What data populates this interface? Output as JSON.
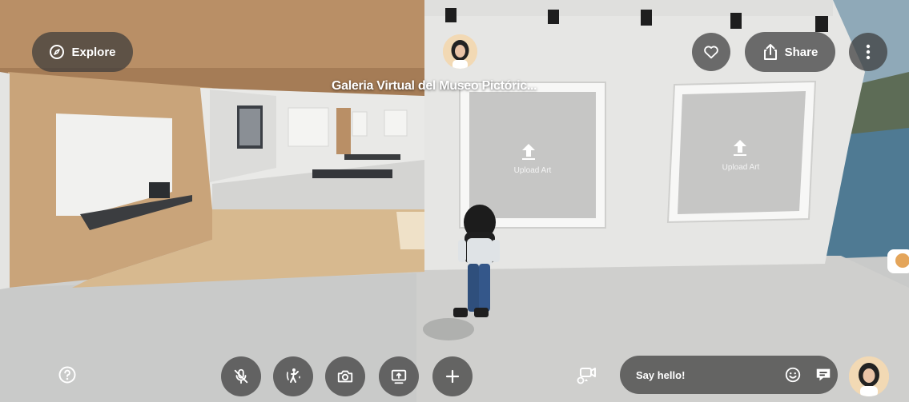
{
  "header": {
    "explore_label": "Explore",
    "share_label": "Share",
    "space_title": "Galeria Virtual del Museo Pictóric..."
  },
  "artworks": [
    {
      "label": "Upload Art"
    },
    {
      "label": "Upload Art"
    }
  ],
  "chat": {
    "placeholder": "Say hello!"
  },
  "icons": {
    "explore": "compass-icon",
    "favorite": "heart-icon",
    "share": "share-icon",
    "more": "more-vertical-icon",
    "help": "help-icon",
    "mic": "mic-off-icon",
    "emote": "dance-icon",
    "camera": "camera-icon",
    "screen_share": "screen-share-icon",
    "add": "plus-icon",
    "camera_view": "camera-view-icon",
    "emoji": "emoji-icon",
    "chat": "chat-icon"
  },
  "colors": {
    "control_bg": "#3a3a3a",
    "wall": "#e6e6e4",
    "floor": "#c9cac9",
    "wood": "#c9a47a",
    "water": "#4f7a93"
  }
}
